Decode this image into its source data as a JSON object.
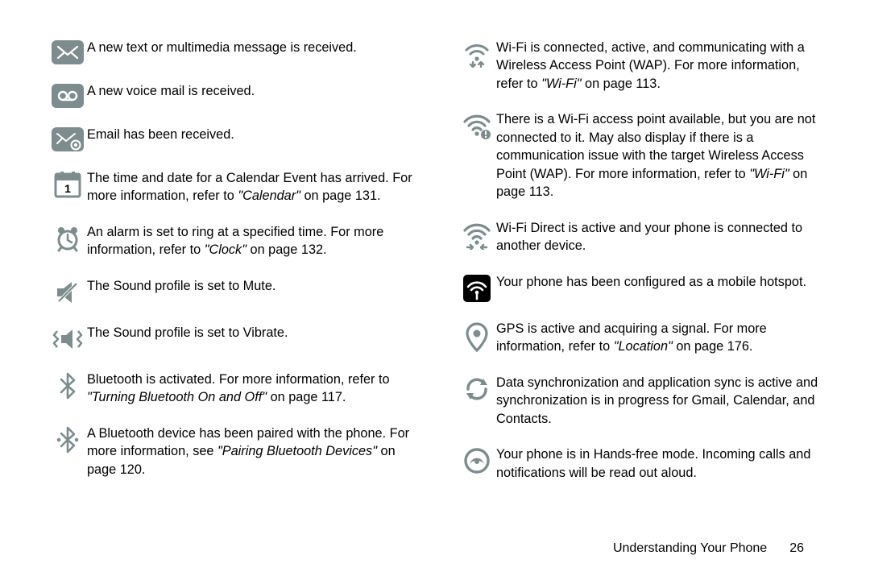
{
  "left": [
    {
      "icon": "message-icon",
      "parts": [
        {
          "t": "text",
          "v": "A new text or multimedia message is received."
        }
      ]
    },
    {
      "icon": "voicemail-icon",
      "parts": [
        {
          "t": "text",
          "v": "A new voice mail is received."
        }
      ]
    },
    {
      "icon": "email-icon",
      "parts": [
        {
          "t": "text",
          "v": "Email has been received."
        }
      ]
    },
    {
      "icon": "calendar-icon",
      "parts": [
        {
          "t": "text",
          "v": "The time and date for a Calendar Event has arrived. For more information, refer to "
        },
        {
          "t": "ref",
          "v": "\"Calendar\""
        },
        {
          "t": "text",
          "v": " on page 131."
        }
      ]
    },
    {
      "icon": "alarm-icon",
      "parts": [
        {
          "t": "text",
          "v": "An alarm is set to ring at a specified time. For more information, refer to "
        },
        {
          "t": "ref",
          "v": "\"Clock\""
        },
        {
          "t": "text",
          "v": " on page 132."
        }
      ]
    },
    {
      "icon": "mute-icon",
      "parts": [
        {
          "t": "text",
          "v": "The Sound profile is set to Mute."
        }
      ]
    },
    {
      "icon": "vibrate-icon",
      "parts": [
        {
          "t": "text",
          "v": "The Sound profile is set to Vibrate."
        }
      ]
    },
    {
      "icon": "bluetooth-icon",
      "parts": [
        {
          "t": "text",
          "v": "Bluetooth is activated. For more information, refer to "
        },
        {
          "t": "ref",
          "v": "\"Turning Bluetooth On and Off\""
        },
        {
          "t": "text",
          "v": " on page 117."
        }
      ]
    },
    {
      "icon": "bluetooth-paired-icon",
      "parts": [
        {
          "t": "text",
          "v": "A Bluetooth device has been paired with the phone. For more information, see "
        },
        {
          "t": "ref",
          "v": "\"Pairing Bluetooth Devices\""
        },
        {
          "t": "text",
          "v": " on page 120."
        }
      ]
    }
  ],
  "right": [
    {
      "icon": "wifi-connected-icon",
      "parts": [
        {
          "t": "text",
          "v": "Wi-Fi is connected, active, and communicating with a Wireless Access Point (WAP). For more information, refer to "
        },
        {
          "t": "ref",
          "v": "\"Wi-Fi\""
        },
        {
          "t": "text",
          "v": " on page 113."
        }
      ]
    },
    {
      "icon": "wifi-alert-icon",
      "parts": [
        {
          "t": "text",
          "v": "There is a Wi-Fi access point available, but you are not connected to it. May also display if there is a communication issue with the target Wireless Access Point (WAP). For more information, refer to "
        },
        {
          "t": "ref",
          "v": "\"Wi-Fi\""
        },
        {
          "t": "text",
          "v": " on page 113."
        }
      ]
    },
    {
      "icon": "wifi-direct-icon",
      "parts": [
        {
          "t": "text",
          "v": "Wi-Fi Direct is active and your phone is connected to another device."
        }
      ]
    },
    {
      "icon": "hotspot-icon",
      "parts": [
        {
          "t": "text",
          "v": "Your phone has been configured as a mobile hotspot."
        }
      ]
    },
    {
      "icon": "gps-icon",
      "parts": [
        {
          "t": "text",
          "v": "GPS is active and acquiring a signal. For more information, refer to "
        },
        {
          "t": "ref",
          "v": "\"Location\""
        },
        {
          "t": "text",
          "v": " on page 176."
        }
      ]
    },
    {
      "icon": "sync-icon",
      "parts": [
        {
          "t": "text",
          "v": "Data synchronization and application sync is active and synchronization is in progress for Gmail, Calendar, and Contacts."
        }
      ]
    },
    {
      "icon": "handsfree-icon",
      "parts": [
        {
          "t": "text",
          "v": "Your phone is in Hands-free mode. Incoming calls and notifications will be read out aloud."
        }
      ]
    }
  ],
  "footer": {
    "section_title": "Understanding Your Phone",
    "page_number": "26"
  }
}
